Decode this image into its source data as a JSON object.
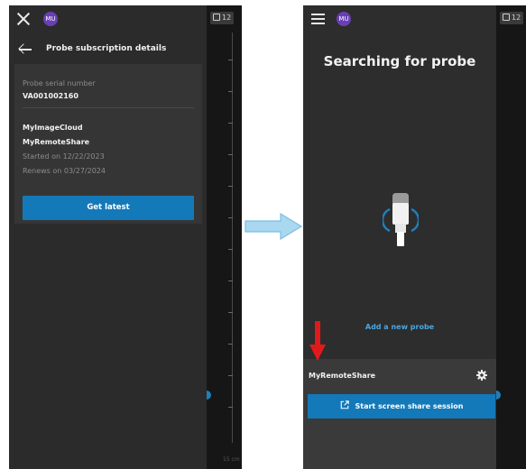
{
  "colors": {
    "accent": "#1479b8",
    "link": "#4aa6e0",
    "avatar": "#6a3fb5",
    "annotation_arrow": "#e01a1a",
    "flow_arrow": "#9fd3ee",
    "drawer_bg": "#2b2b2b",
    "card_bg": "#353535"
  },
  "left_screen": {
    "avatar_initials": "MU",
    "close_icon": "close-icon",
    "strip_badge": "12",
    "header": {
      "back_icon": "back-arrow-icon",
      "title": "Probe subscription details"
    },
    "card": {
      "serial_label": "Probe serial number",
      "serial_value": "VA001002160",
      "subscriptions": [
        "MyImageCloud",
        "MyRemoteShare"
      ],
      "started": "Started on 12/22/2023",
      "renews": "Renews on 03/27/2024",
      "button_label": "Get latest"
    },
    "strip_footer": "15 cm"
  },
  "right_screen": {
    "avatar_initials": "MU",
    "menu_icon": "hamburger-icon",
    "strip_badge": "12",
    "title": "Searching for probe",
    "probe_icon": "ultrasound-probe-icon",
    "add_probe_link": "Add a new probe",
    "share_panel": {
      "name": "MyRemoteShare",
      "settings_icon": "gear-icon",
      "button_icon": "external-link-icon",
      "button_label": "Start screen share session"
    }
  },
  "connector_icon": "right-arrow-icon",
  "annotation_icon": "red-down-arrow-icon"
}
